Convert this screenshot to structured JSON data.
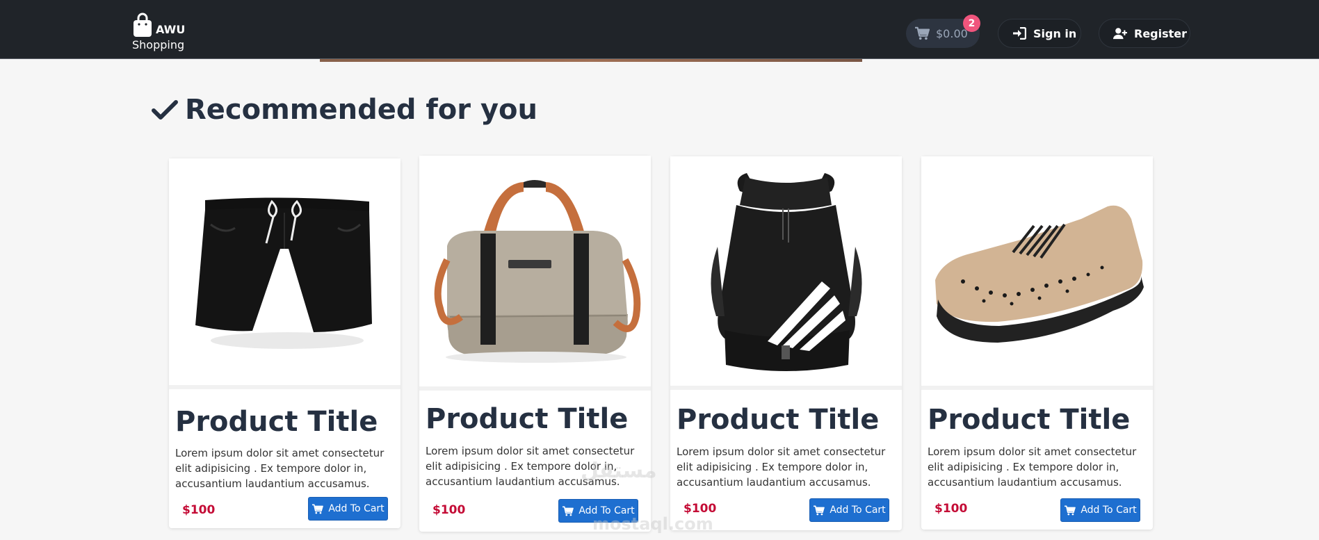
{
  "navbar": {
    "brand_name": "AWU",
    "brand_sub": "Shopping",
    "cart_total": "$0.00",
    "cart_count": "2",
    "signin_label": "Sign in",
    "register_label": "Register"
  },
  "section": {
    "heading": "Recommended for you"
  },
  "products": [
    {
      "title": "Product Title",
      "description": "Lorem ipsum dolor sit amet consectetur elit adipisicing . Ex tempore dolor in, accusantium laudantium accusamus.",
      "price": "$100",
      "button_label": "Add To Cart",
      "image": "black-shorts"
    },
    {
      "title": "Product Title",
      "description": "Lorem ipsum dolor sit amet consectetur elit adipisicing . Ex tempore dolor in, accusantium laudantium accusamus.",
      "price": "$100",
      "button_label": "Add To Cart",
      "image": "travel-duffel-bag"
    },
    {
      "title": "Product Title",
      "description": "Lorem ipsum dolor sit amet consectetur elit adipisicing . Ex tempore dolor in, accusantium laudantium accusamus.",
      "price": "$100",
      "button_label": "Add To Cart",
      "image": "drawstring-backpack"
    },
    {
      "title": "Product Title",
      "description": "Lorem ipsum dolor sit amet consectetur elit adipisicing . Ex tempore dolor in, accusantium laudantium accusamus.",
      "price": "$100",
      "button_label": "Add To Cart",
      "image": "knit-sneaker"
    }
  ],
  "watermark": {
    "arabic": "مستقل",
    "latin": "mostaql.com"
  },
  "colors": {
    "navbar_bg": "#202429",
    "accent_button": "#1e6fd0",
    "price": "#c40c36",
    "badge": "#f0557d",
    "heading": "#253041"
  }
}
